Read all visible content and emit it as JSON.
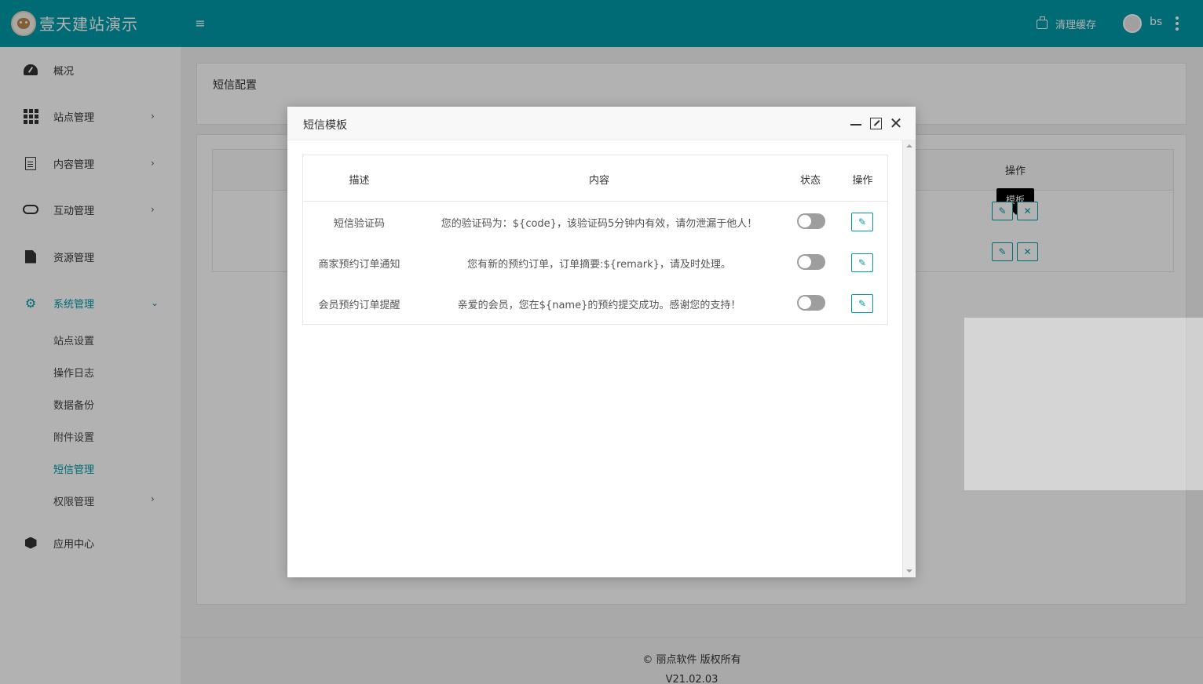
{
  "header": {
    "site_title": "壹天建站演示",
    "clear_cache_label": "清理缓存",
    "user_name": "bs"
  },
  "sidebar": {
    "items": [
      {
        "label": "概况",
        "icon": "dashboard-icon"
      },
      {
        "label": "站点管理",
        "icon": "grid-icon"
      },
      {
        "label": "内容管理",
        "icon": "document-icon"
      },
      {
        "label": "互动管理",
        "icon": "handshake-icon"
      },
      {
        "label": "资源管理",
        "icon": "file-icon"
      },
      {
        "label": "系统管理",
        "icon": "gear-icon"
      },
      {
        "label": "应用中心",
        "icon": "cube-icon"
      }
    ],
    "system_sub": [
      {
        "label": "站点设置"
      },
      {
        "label": "操作日志"
      },
      {
        "label": "数据备份"
      },
      {
        "label": "附件设置"
      },
      {
        "label": "短信管理"
      },
      {
        "label": "权限管理"
      }
    ]
  },
  "main": {
    "page_title": "短信配置",
    "bg_table_op_header": "操作",
    "tooltip": "模板"
  },
  "modal": {
    "title": "短信模板",
    "columns": {
      "desc": "描述",
      "content": "内容",
      "status": "状态",
      "op": "操作"
    },
    "rows": [
      {
        "desc": "短信验证码",
        "content": "您的验证码为：${code}，该验证码5分钟内有效，请勿泄漏于他人！",
        "enabled": false
      },
      {
        "desc": "商家预约订单通知",
        "content": "您有新的预约订单，订单摘要:${remark}，请及时处理。",
        "enabled": false
      },
      {
        "desc": "会员预约订单提醒",
        "content": "亲爱的会员，您在${name}的预约提交成功。感谢您的支持！",
        "enabled": false
      }
    ]
  },
  "footer": {
    "copyright": "© 丽点软件 版权所有",
    "version": "V21.02.03"
  },
  "colors": {
    "primary": "#009aa6",
    "switch_off": "#9e9e9e"
  }
}
